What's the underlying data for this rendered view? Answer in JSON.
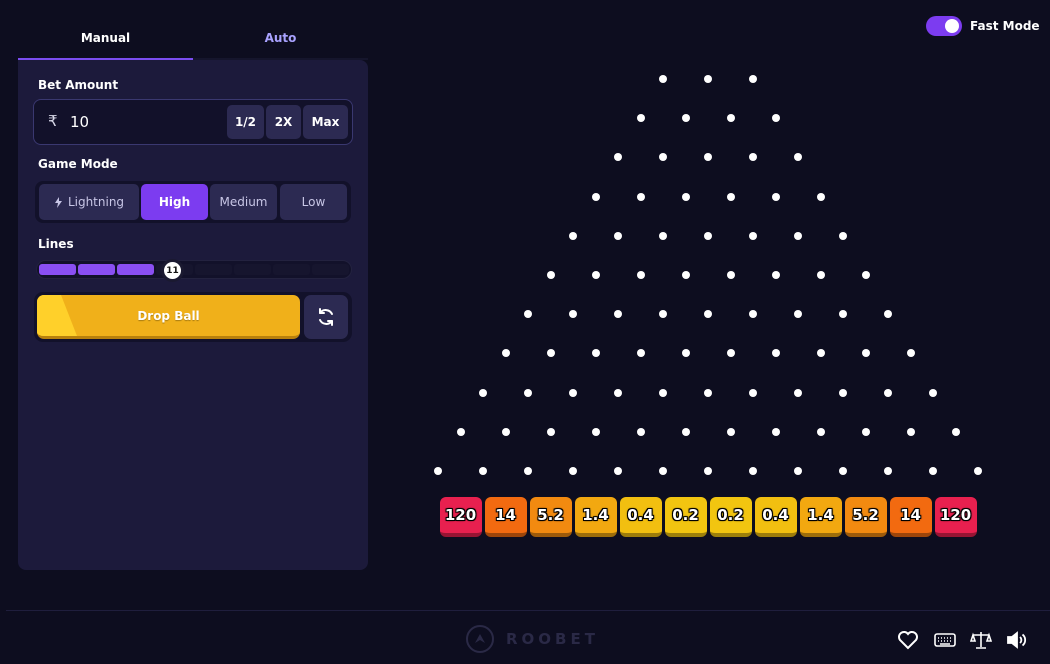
{
  "tabs": {
    "manual": "Manual",
    "auto": "Auto"
  },
  "bet": {
    "label": "Bet Amount",
    "currency": "₹",
    "value": "10",
    "half": "1/2",
    "double": "2X",
    "max": "Max"
  },
  "game_mode": {
    "label": "Game Mode",
    "options": [
      "Lightning",
      "High",
      "Medium",
      "Low"
    ],
    "selected": "High"
  },
  "lines": {
    "label": "Lines",
    "value": "11",
    "segments": 8,
    "filled": 3
  },
  "drop_button": "Drop Ball",
  "fast_mode": {
    "label": "Fast Mode",
    "on": true
  },
  "board": {
    "rows": 11,
    "multipliers": [
      "120",
      "14",
      "5.2",
      "1.4",
      "0.4",
      "0.2",
      "0.2",
      "0.4",
      "1.4",
      "5.2",
      "14",
      "120"
    ],
    "bucket_colors": [
      "#e8204f",
      "#f26a10",
      "#f28a10",
      "#f2a810",
      "#f2bf10",
      "#f2c510",
      "#f2c510",
      "#f2bf10",
      "#f2a810",
      "#f28a10",
      "#f26a10",
      "#e8204f"
    ]
  },
  "footer": {
    "brand": "ROOBET",
    "icons": [
      "heart-icon",
      "keyboard-icon",
      "scale-icon",
      "speaker-icon"
    ]
  },
  "colors": {
    "accent": "#7c3cf0",
    "panel": "#1c1a3b",
    "background": "#0d0d1f",
    "drop_button": "#f0b01a"
  }
}
